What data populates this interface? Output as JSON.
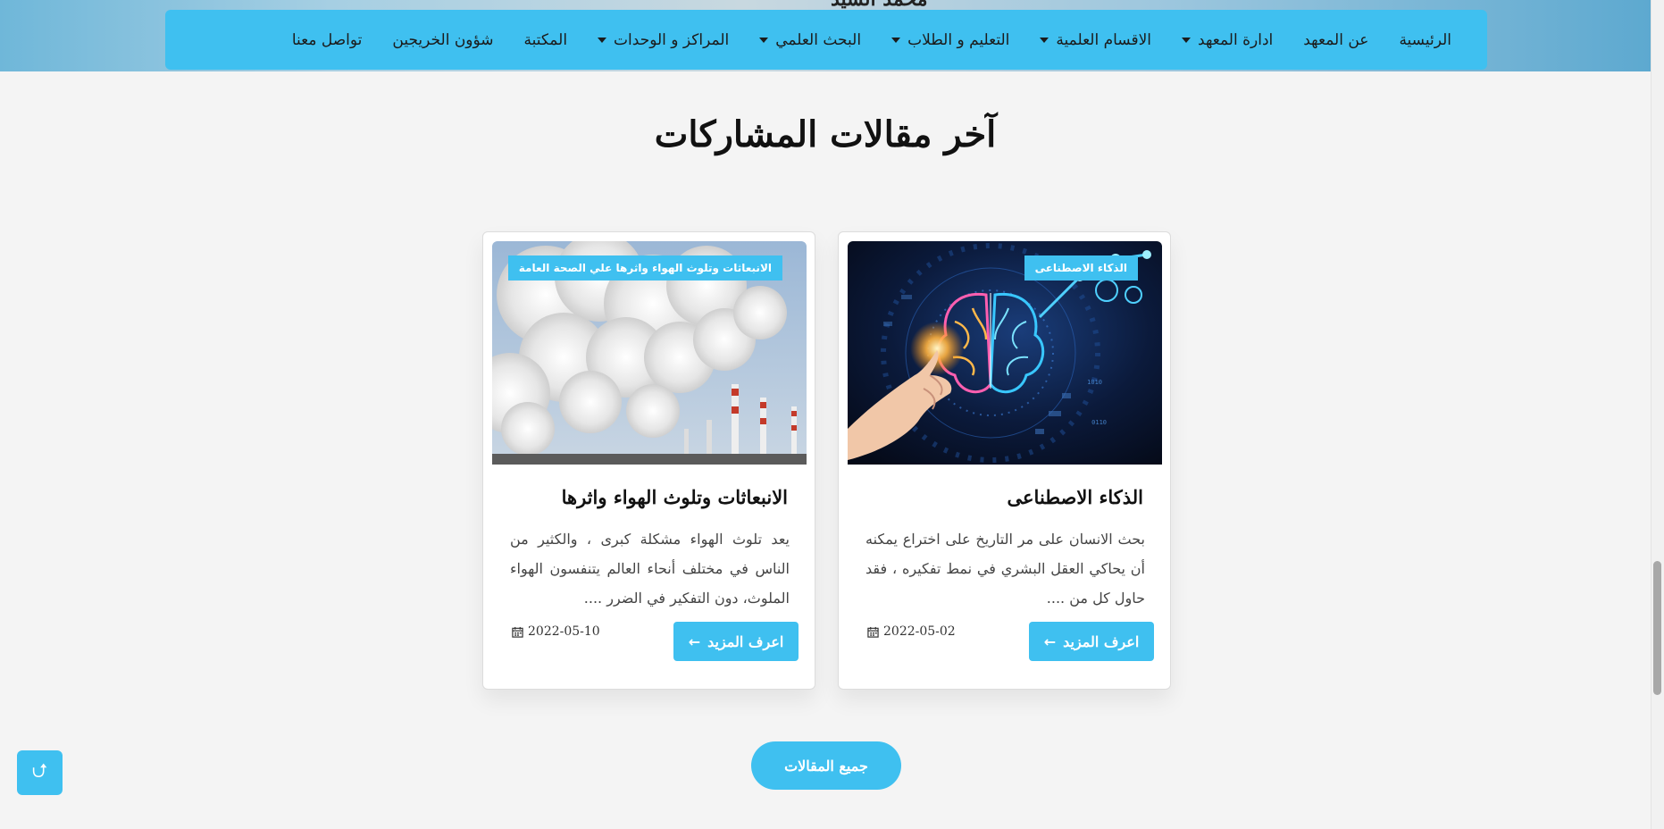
{
  "hero": {
    "name_partial": "محمد السيد"
  },
  "nav": {
    "items": [
      {
        "label": "الرئيسية",
        "dropdown": false
      },
      {
        "label": "عن المعهد",
        "dropdown": false
      },
      {
        "label": "ادارة المعهد",
        "dropdown": true
      },
      {
        "label": "الاقسام العلمية",
        "dropdown": true
      },
      {
        "label": "التعليم و الطلاب",
        "dropdown": true
      },
      {
        "label": "البحث العلمي",
        "dropdown": true
      },
      {
        "label": "المراكز و الوحدات",
        "dropdown": true
      },
      {
        "label": "المكتبة",
        "dropdown": false
      },
      {
        "label": "شؤون الخريجين",
        "dropdown": false
      },
      {
        "label": "تواصل معنا",
        "dropdown": false
      }
    ]
  },
  "section": {
    "title": "آخر مقالات المشاركات"
  },
  "articles": [
    {
      "tag": "الذكاء الاصطناعى",
      "title": "الذكاء الاصطناعى",
      "excerpt": "بحث الانسان على مر التاريخ على اختراع يمكنه أن يحاكي العقل البشري في نمط تفكيره ، فقد حاول كل من ....",
      "date": "2022-05-02",
      "button": "اعرف المزيد",
      "image": "ai-brain-image"
    },
    {
      "tag": "الانبعاثات وتلوث الهواء واثرها علي الصحة العامة",
      "title": "الانبعاثات وتلوث الهواء واثرها",
      "excerpt": "يعد تلوث الهواء مشكلة كبرى ، والكثير من الناس في مختلف أنحاء العالم يتنفسون الهواء الملوث، دون التفكير في الضرر ....",
      "date": "2022-05-10",
      "button": "اعرف المزيد",
      "image": "smokestacks-image"
    }
  ],
  "all_articles_button": "جميع المقالات",
  "colors": {
    "accent": "#3fc0f0",
    "background": "#f4f4f4"
  },
  "icons": {
    "calendar": "calendar-icon",
    "arrow": "arrow-left-icon",
    "top": "scroll-top-icon"
  }
}
